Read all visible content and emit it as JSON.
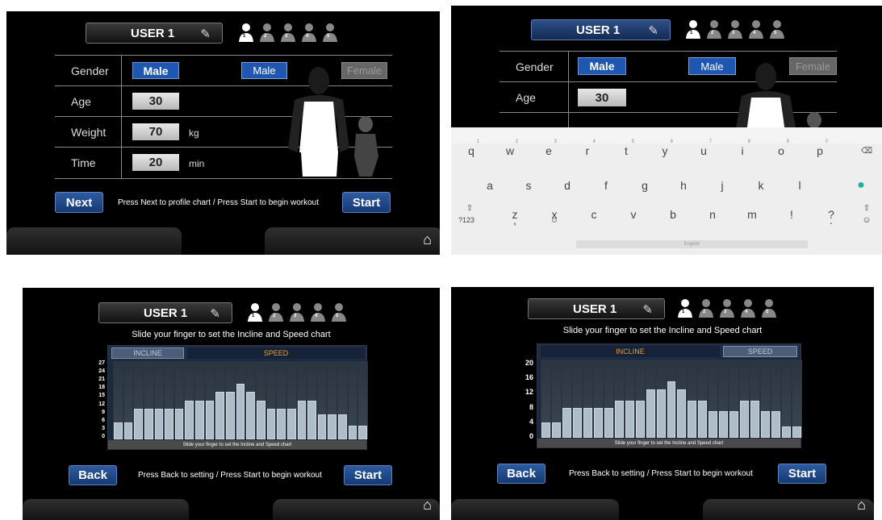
{
  "common": {
    "user_label": "USER 1",
    "profile_numbers": [
      "1",
      "2",
      "3",
      "4",
      "5"
    ]
  },
  "form": {
    "rows": [
      {
        "label": "Gender",
        "value": "Male",
        "unit": ""
      },
      {
        "label": "Age",
        "value": "30",
        "unit": ""
      },
      {
        "label": "Weight",
        "value": "70",
        "unit": "kg"
      },
      {
        "label": "Time",
        "value": "20",
        "unit": "min"
      }
    ],
    "gender_options": [
      "Male",
      "Female"
    ],
    "next_label": "Next",
    "start_label": "Start",
    "hint": "Press Next to profile chart / Press Start to begin workout"
  },
  "keyboard": {
    "row1": [
      "q",
      "w",
      "e",
      "r",
      "t",
      "y",
      "u",
      "i",
      "o",
      "p"
    ],
    "row1_nums": [
      "1",
      "2",
      "3",
      "4",
      "5",
      "6",
      "7",
      "8",
      "9",
      "0"
    ],
    "row2": [
      "a",
      "s",
      "d",
      "f",
      "g",
      "h",
      "j",
      "k",
      "l"
    ],
    "row3": [
      "z",
      "x",
      "c",
      "v",
      "b",
      "n",
      "m",
      "!",
      "?"
    ],
    "sym_label": "?123",
    "comma": ",",
    "space_label": "English",
    "period": "."
  },
  "chart_screen": {
    "caption": "Slide your finger to set the Incline and Speed chart",
    "slide_hint": "Slide your finger to set the Incline and Speed chart",
    "tab_incline": "INCLINE",
    "tab_speed": "SPEED",
    "back_label": "Back",
    "start_label": "Start",
    "hint": "Press Back to setting / Press Start to begin workout"
  },
  "chart_data": [
    {
      "type": "bar",
      "active_tab": "SPEED",
      "yticks": [
        "27",
        "24",
        "21",
        "18",
        "15",
        "12",
        "9",
        "6",
        "3",
        "0"
      ],
      "ylim": [
        0,
        27
      ],
      "values": [
        6,
        6,
        11,
        11,
        11,
        11,
        11,
        14,
        14,
        14,
        17,
        17,
        20,
        17,
        14,
        11,
        11,
        11,
        14,
        14,
        9,
        9,
        9,
        5,
        5
      ]
    },
    {
      "type": "bar",
      "active_tab": "INCLINE",
      "yticks": [
        "20",
        "16",
        "12",
        "8",
        "4",
        "0"
      ],
      "ylim": [
        0,
        20
      ],
      "values": [
        4,
        4,
        8,
        8,
        8,
        8,
        8,
        10,
        10,
        10,
        13,
        13,
        15,
        13,
        10,
        10,
        7,
        7,
        7,
        10,
        10,
        7,
        7,
        3,
        3
      ]
    }
  ],
  "colors": {
    "accent": "#1f57b0",
    "active_tab": "#f0a020",
    "bar": "#aebdca"
  }
}
